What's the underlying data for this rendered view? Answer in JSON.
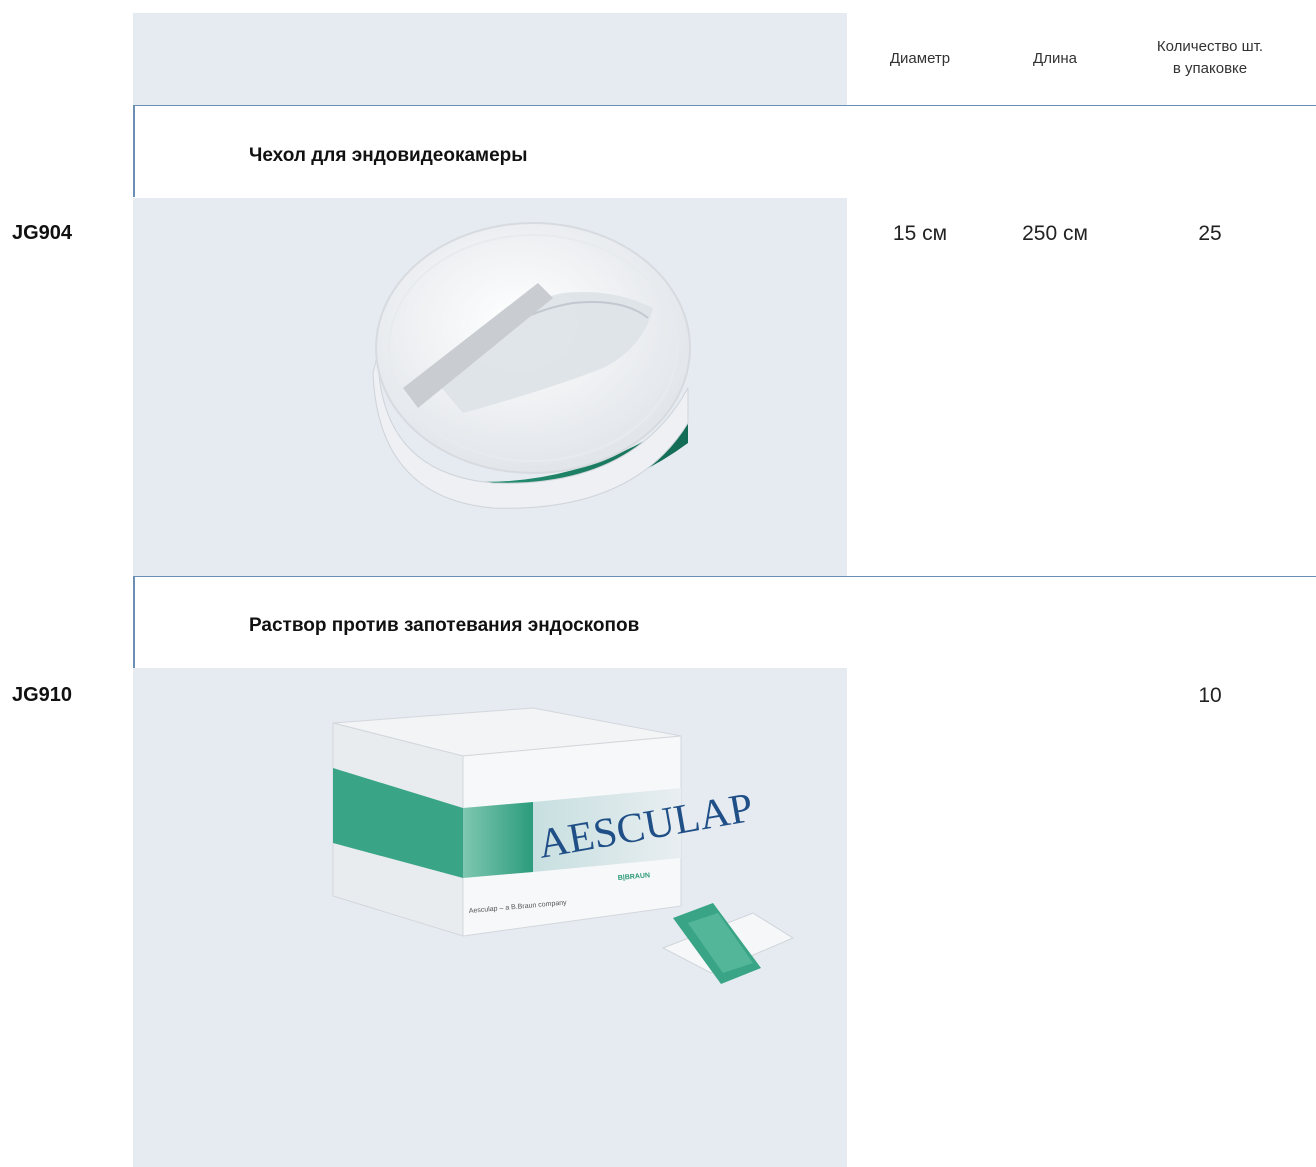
{
  "columns": {
    "diameter": "Диаметр",
    "length": "Длина",
    "qty_line1": "Количество шт.",
    "qty_line2": "в упаковке"
  },
  "products": [
    {
      "title": "Чехол для эндовидеокамеры",
      "code": "JG904",
      "diameter": "15 см",
      "length": "250 см",
      "qty": "25",
      "image": "camera-cover-roll"
    },
    {
      "title": "Раствор против запотевания эндоскопов",
      "code": "JG910",
      "diameter": "",
      "length": "",
      "qty": "10",
      "image": "anti-fog-solution-box"
    }
  ],
  "box_brand": {
    "logo": "AESCULAP",
    "tagline": "Aesculap – a B.Braun company",
    "maker": "B|BRAUN"
  },
  "colors": {
    "panel_bg": "#e6ebf2",
    "rule": "#6b8fb3",
    "accent_green": "#1f8a6e"
  }
}
